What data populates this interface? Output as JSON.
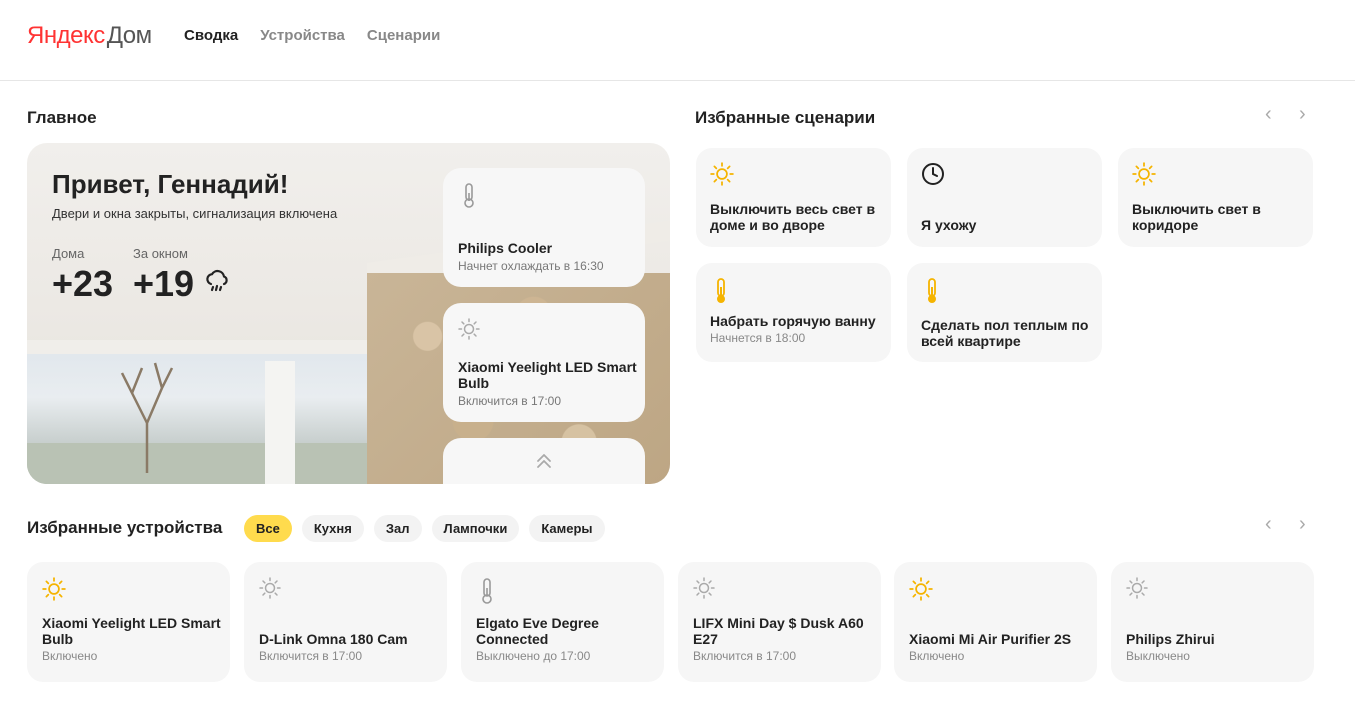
{
  "header": {
    "logo_ya": "Яндекс",
    "logo_dom": "Дом",
    "nav": [
      {
        "label": "Сводка",
        "active": true
      },
      {
        "label": "Устройства",
        "active": false
      },
      {
        "label": "Сценарии",
        "active": false
      }
    ]
  },
  "main": {
    "title": "Главное",
    "greeting": "Привет, Геннадий!",
    "status": "Двери и окна закрыты, сигнализация включена",
    "home_label": "Дома",
    "home_temp": "+23",
    "outside_label": "За окном",
    "outside_temp": "+19",
    "weather_icon": "cloud-rain-icon",
    "cards": [
      {
        "icon": "thermometer-icon",
        "title": "Philips Cooler",
        "sub": "Начнет охлаждать в 16:30"
      },
      {
        "icon": "bulb-off-icon",
        "title": "Xiaomi Yeelight LED Smart Bulb",
        "sub": "Включится в 17:00"
      },
      {
        "icon": "chevrons-up-icon",
        "title": "",
        "sub": ""
      }
    ]
  },
  "scenarios": {
    "title": "Избранные сценарии",
    "items": [
      {
        "icon": "sun-icon",
        "title": "Выключить весь свет в доме и во дворе",
        "sub": ""
      },
      {
        "icon": "clock-icon",
        "title": "Я ухожу",
        "sub": ""
      },
      {
        "icon": "sun-icon",
        "title": "Выключить свет в коридоре",
        "sub": ""
      },
      {
        "icon": "thermometer-hot-icon",
        "title": "Набрать горячую ванну",
        "sub": "Начнется в 18:00"
      },
      {
        "icon": "thermometer-hot-icon",
        "title": "Сделать пол теплым по всей квартире",
        "sub": ""
      }
    ]
  },
  "devices": {
    "title": "Избранные устройства",
    "filters": [
      {
        "label": "Все",
        "active": true
      },
      {
        "label": "Кухня",
        "active": false
      },
      {
        "label": "Зал",
        "active": false
      },
      {
        "label": "Лампочки",
        "active": false
      },
      {
        "label": "Камеры",
        "active": false
      }
    ],
    "items": [
      {
        "icon": "sun-icon",
        "title": "Xiaomi Yeelight LED Smart Bulb",
        "sub": "Включено"
      },
      {
        "icon": "bulb-off-icon",
        "title": "D-Link Omna 180 Cam",
        "sub": "Включится в 17:00"
      },
      {
        "icon": "thermometer-icon",
        "title": "Elgato Eve Degree Connected",
        "sub": "Выключено до 17:00"
      },
      {
        "icon": "bulb-off-icon",
        "title": "LIFX Mini Day $ Dusk A60 E27",
        "sub": "Включится в 17:00"
      },
      {
        "icon": "sun-icon",
        "title": "Xiaomi Mi Air Purifier 2S",
        "sub": "Включено"
      },
      {
        "icon": "bulb-off-icon",
        "title": "Philips Zhirui",
        "sub": "Выключено"
      }
    ]
  },
  "colors": {
    "accent": "#ffdb4d",
    "sun": "#f5b400",
    "logo_red": "#ff3333"
  },
  "arrows": {
    "prev": "‹",
    "next": "›"
  }
}
